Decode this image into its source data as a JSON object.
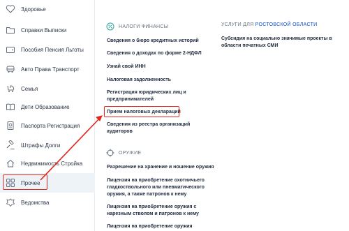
{
  "sidebar": {
    "items": [
      {
        "label": "Здоровье",
        "icon": "health-icon"
      },
      {
        "label": "Справки Выписки",
        "icon": "folder-icon"
      },
      {
        "label": "Пособия Пенсия Льготы",
        "icon": "wallet-icon"
      },
      {
        "label": "Авто Права Транспорт",
        "icon": "car-icon"
      },
      {
        "label": "Семья",
        "icon": "stroller-icon"
      },
      {
        "label": "Дети Образование",
        "icon": "book-icon"
      },
      {
        "label": "Паспорта Регистрация",
        "icon": "passport-icon"
      },
      {
        "label": "Штрафы Долги",
        "icon": "gavel-icon"
      },
      {
        "label": "Недвижимость Стройка",
        "icon": "house-icon"
      },
      {
        "label": "Прочее",
        "icon": "grid-icon"
      },
      {
        "label": "Ведомства",
        "icon": "emblem-icon"
      }
    ],
    "active_index": 9
  },
  "finance": {
    "title": "НАЛОГИ ФИНАНСЫ",
    "links": [
      "Сведения о бюро кредитных историй",
      "Сведения о доходах по форме 2-НДФЛ",
      "Узнай свой ИНН",
      "Налоговая задолженность",
      "Регистрация юридических лиц и",
      "предпринимателей",
      "Прием налоговых деклараций",
      "Сведения из реестра организаций",
      "аудиторов"
    ]
  },
  "weapons": {
    "title": "ОРУЖИЕ",
    "links": [
      "Разрешение на хранение и ношение оружия",
      "Лицензия на приобретение охотничьего",
      "гладкоствольного или пневматического",
      "оружия, а также патронов к нему",
      "Лицензия на приобретение оружия с",
      "нарезным стволом и патронов к нему",
      "Лицензия на приобретение оружия"
    ]
  },
  "region": {
    "title_prefix": "УСЛУГИ ДЛЯ",
    "title_region": "РОСТОВСКОЙ ОБЛАСТИ",
    "links": [
      "Субсидия на социально значимые проекты в",
      "области печатных СМИ"
    ]
  },
  "colors": {
    "accent": "#0d4cd3",
    "highlight": "#e3261b",
    "active_bg": "#eef3f8",
    "text": "#1f2b3d",
    "muted": "#66727f"
  }
}
